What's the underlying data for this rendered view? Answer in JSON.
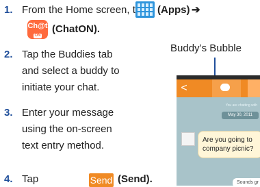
{
  "steps": [
    {
      "num": "1.",
      "lines": [
        "From the Home screen, tap",
        "(ChatON)."
      ],
      "apps_label": "(Apps)",
      "arrow": "➔"
    },
    {
      "num": "2.",
      "lines": [
        "Tap the Buddies tab",
        "and select a buddy to",
        "initiate your chat."
      ]
    },
    {
      "num": "3.",
      "lines": [
        "Enter your message",
        "using the on-screen",
        "text entry method."
      ]
    },
    {
      "num": "4.",
      "lines": [
        "Tap",
        "(Send)."
      ]
    }
  ],
  "chaton_icon": {
    "text": "Ch@t",
    "sub": "ON"
  },
  "send_button": "Send",
  "caption": "Buddy’s Bubble",
  "phone": {
    "back_arrow": "<",
    "status_text": "You are chatting with",
    "date": "May 30, 2011",
    "bubble_text": [
      "Are you going to",
      "company picnic?"
    ],
    "reply_text": "Sounds gr"
  }
}
